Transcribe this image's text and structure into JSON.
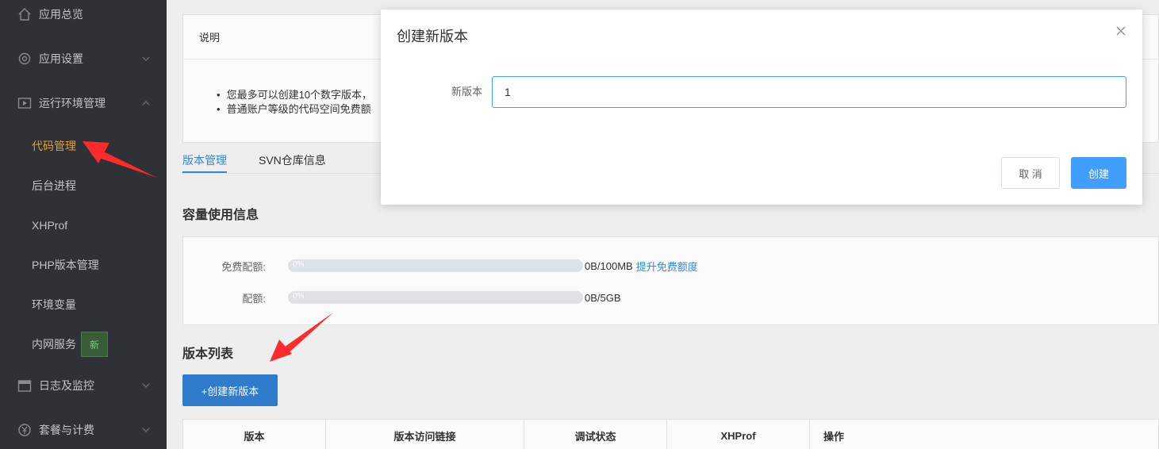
{
  "sidebar": {
    "items": [
      {
        "label": "应用总览",
        "icon": "home-icon"
      },
      {
        "label": "应用设置",
        "icon": "gear-icon",
        "chevron": "chevron-down-icon"
      },
      {
        "label": "运行环境管理",
        "icon": "play-screen-icon",
        "chevron": "chevron-up-icon"
      },
      {
        "label": "代码管理",
        "active": true
      },
      {
        "label": "后台进程"
      },
      {
        "label": "XHProf"
      },
      {
        "label": "PHP版本管理"
      },
      {
        "label": "环境变量"
      },
      {
        "label": "内网服务",
        "badge": "新"
      },
      {
        "label": "日志及监控",
        "icon": "calendar-icon",
        "chevron": "chevron-down-icon"
      },
      {
        "label": "套餐与计费",
        "icon": "yen-circle-icon",
        "chevron": "chevron-down-icon"
      }
    ],
    "active_color": "#e6a23c"
  },
  "main": {
    "desc_title": "说明",
    "desc_items": [
      "您最多可以创建10个数字版本，",
      "普通账户等级的代码空间免费额"
    ],
    "tabs": [
      "版本管理",
      "SVN仓库信息"
    ],
    "capacity_title": "容量使用信息",
    "capacity": [
      {
        "label": "免费配额:",
        "percent": "0%",
        "value": "0B/100MB",
        "link": "提升免费额度",
        "progress": 0
      },
      {
        "label": "配额:",
        "percent": "0%",
        "value": "0B/5GB",
        "progress": 0
      }
    ],
    "version_list_title": "版本列表",
    "create_button": "+创建新版本",
    "table_headers": [
      "版本",
      "版本访问链接",
      "调试状态",
      "XHProf",
      "操作"
    ]
  },
  "modal": {
    "title": "创建新版本",
    "field_label": "新版本",
    "field_value": "1",
    "cancel_label": "取 消",
    "ok_label": "创建"
  },
  "colors": {
    "primary": "#409eff",
    "sidebar_bg": "#2f3237",
    "link": "#2f8fd8",
    "annotation": "#ff2a2a"
  }
}
